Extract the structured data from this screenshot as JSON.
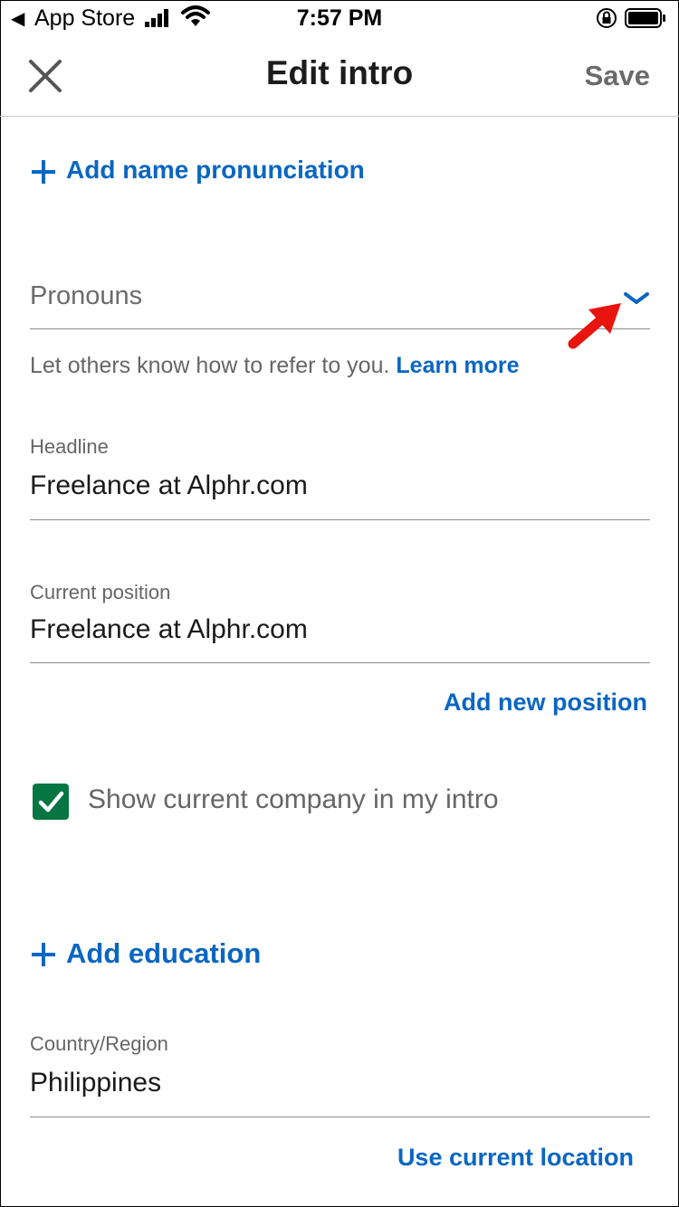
{
  "status_bar": {
    "back_app": "App Store",
    "time": "7:57 PM",
    "icons": [
      "back-triangle-icon",
      "signal-icon",
      "wifi-icon",
      "orientation-lock-icon",
      "battery-icon"
    ]
  },
  "header": {
    "title": "Edit intro",
    "save_label": "Save",
    "close_icon": "close-icon"
  },
  "form": {
    "add_pronunciation": "Add name pronunciation",
    "pronouns": {
      "placeholder": "Pronouns",
      "helper": "Let others know how to refer to you.",
      "learn_more": "Learn more"
    },
    "headline": {
      "label": "Headline",
      "value": "Freelance at Alphr.com"
    },
    "current_position": {
      "label": "Current position",
      "value": "Freelance at Alphr.com"
    },
    "add_position": "Add new position",
    "show_company": {
      "label": "Show current company in my intro",
      "checked": true
    },
    "add_education": "Add education",
    "country": {
      "label": "Country/Region",
      "value": "Philippines"
    },
    "use_location": "Use current location"
  },
  "colors": {
    "accent": "#0a66c2",
    "checkbox": "#057642",
    "annotation_arrow": "#e8150f"
  }
}
